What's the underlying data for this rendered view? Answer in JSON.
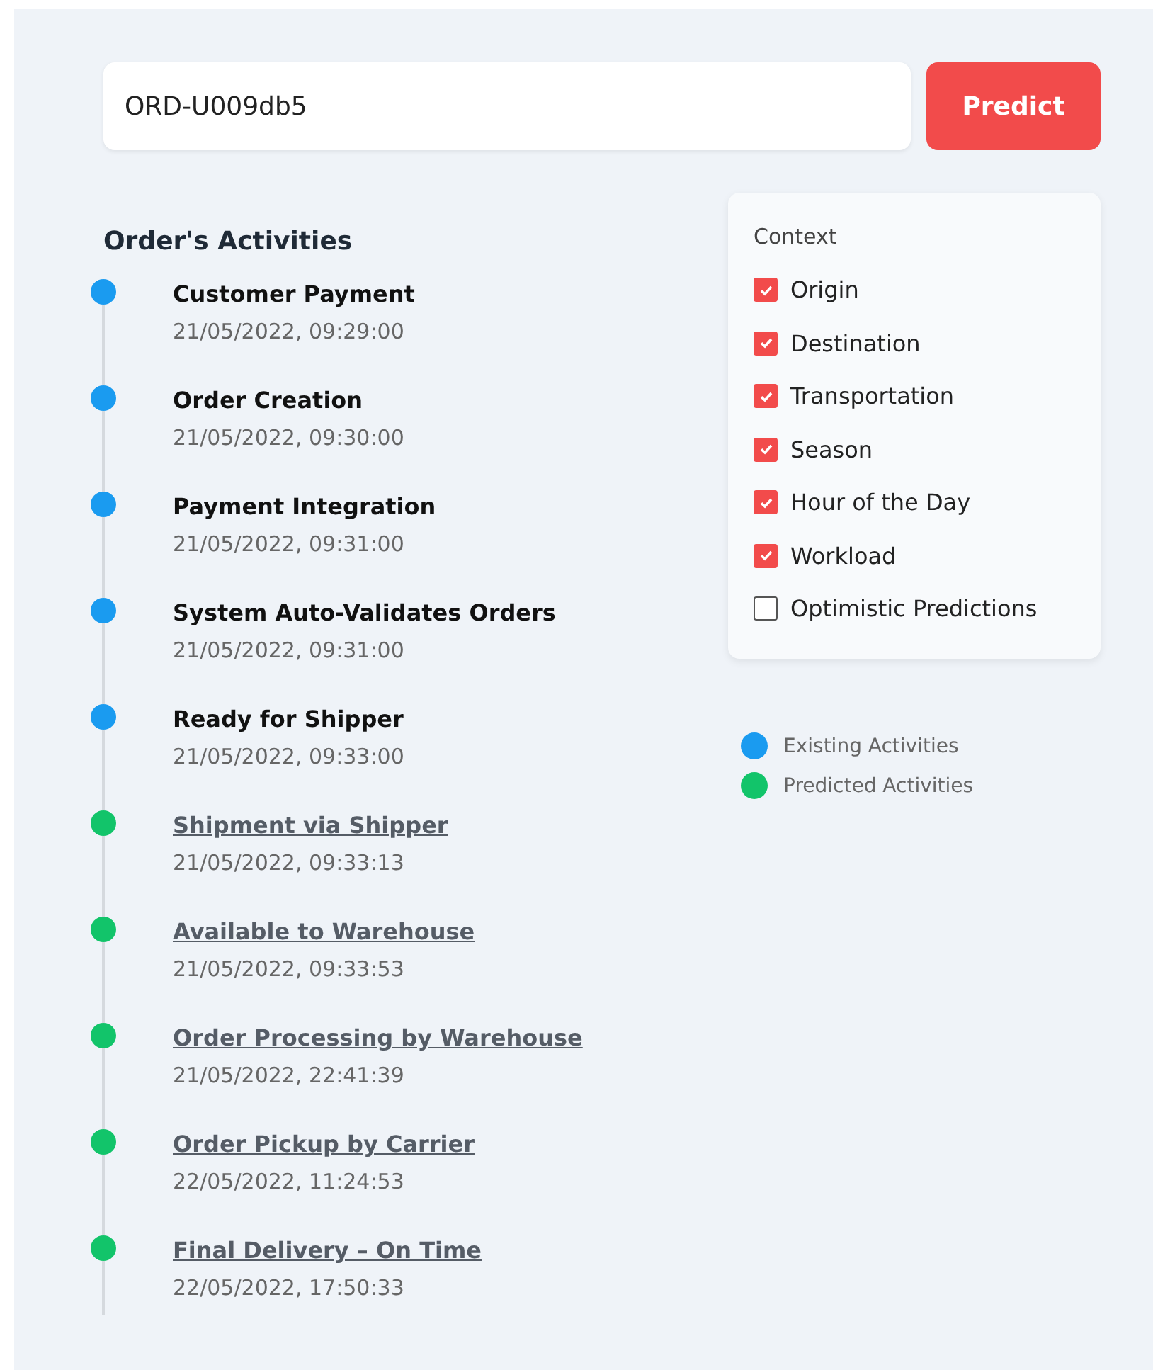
{
  "order_input": {
    "value": "ORD-U009db5"
  },
  "predict_button": {
    "label": "Predict"
  },
  "activities": {
    "title": "Order's Activities",
    "items": [
      {
        "kind": "existing",
        "color": "#1a9bf0",
        "name": "Customer Payment",
        "time": "21/05/2022, 09:29:00"
      },
      {
        "kind": "existing",
        "color": "#1a9bf0",
        "name": "Order Creation",
        "time": "21/05/2022, 09:30:00"
      },
      {
        "kind": "existing",
        "color": "#1a9bf0",
        "name": "Payment Integration",
        "time": "21/05/2022, 09:31:00"
      },
      {
        "kind": "existing",
        "color": "#1a9bf0",
        "name": "System Auto-Validates Orders",
        "time": "21/05/2022, 09:31:00"
      },
      {
        "kind": "existing",
        "color": "#1a9bf0",
        "name": "Ready for Shipper",
        "time": "21/05/2022, 09:33:00"
      },
      {
        "kind": "predicted",
        "color": "#12c46a",
        "name": "Shipment via Shipper",
        "time": "21/05/2022, 09:33:13"
      },
      {
        "kind": "predicted",
        "color": "#12c46a",
        "name": "Available to Warehouse",
        "time": "21/05/2022, 09:33:53"
      },
      {
        "kind": "predicted",
        "color": "#12c46a",
        "name": "Order Processing by Warehouse",
        "time": "21/05/2022, 22:41:39"
      },
      {
        "kind": "predicted",
        "color": "#12c46a",
        "name": "Order Pickup by Carrier",
        "time": "22/05/2022, 11:24:53"
      },
      {
        "kind": "predicted",
        "color": "#12c46a",
        "name": "Final Delivery – On Time",
        "time": "22/05/2022, 17:50:33"
      }
    ]
  },
  "context": {
    "title": "Context",
    "options": [
      {
        "label": "Origin",
        "checked": true
      },
      {
        "label": "Destination",
        "checked": true
      },
      {
        "label": "Transportation",
        "checked": true
      },
      {
        "label": "Season",
        "checked": true
      },
      {
        "label": "Hour of the Day",
        "checked": true
      },
      {
        "label": "Workload",
        "checked": true
      },
      {
        "label": "Optimistic Predictions",
        "checked": false
      }
    ]
  },
  "legend": [
    {
      "label": "Existing Activities",
      "color": "#1a9bf0"
    },
    {
      "label": "Predicted Activities",
      "color": "#12c46a"
    }
  ]
}
